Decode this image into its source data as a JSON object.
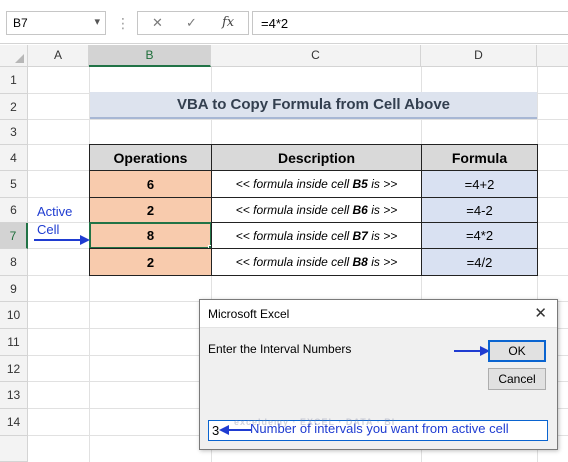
{
  "formula_bar": {
    "name_box": "B7",
    "cancel_glyph": "✕",
    "enter_glyph": "✓",
    "fx_label": "fx",
    "formula": "=4*2"
  },
  "columns": [
    "A",
    "B",
    "C",
    "D"
  ],
  "rows": [
    "1",
    "2",
    "3",
    "4",
    "5",
    "6",
    "7",
    "8",
    "9",
    "10",
    "11",
    "12",
    "13",
    "14"
  ],
  "sheet": {
    "title": "VBA to Copy Formula from Cell Above",
    "headers": [
      "Operations",
      "Description",
      "Formula"
    ],
    "data_rows": [
      {
        "operation": "6",
        "desc_prefix": "<< formula inside cell ",
        "desc_ref": "B5",
        "desc_suffix": " is >>",
        "formula": "=4+2"
      },
      {
        "operation": "2",
        "desc_prefix": "<< formula inside cell ",
        "desc_ref": "B6",
        "desc_suffix": " is >>",
        "formula": "=4-2"
      },
      {
        "operation": "8",
        "desc_prefix": "<< formula inside cell ",
        "desc_ref": "B7",
        "desc_suffix": " is >>",
        "formula": "=4*2"
      },
      {
        "operation": "2",
        "desc_prefix": "<< formula inside cell ",
        "desc_ref": "B8",
        "desc_suffix": " is >>",
        "formula": "=4/2"
      }
    ]
  },
  "annotation": {
    "active_line1": "Active",
    "active_line2": "Cell",
    "input_note": "Number of intervals you want from active cell"
  },
  "dialog": {
    "title": "Microsoft Excel",
    "prompt": "Enter the Interval Numbers",
    "ok_label": "OK",
    "cancel_label": "Cancel",
    "input_value": "3"
  },
  "watermark": "exceldemy · EXCEL · DATA · BI",
  "colors": {
    "accent_green": "#217346",
    "annotation_blue": "#1f3cd1",
    "operations_fill": "#f8cbad",
    "formula_fill": "#d9e1f2",
    "title_fill": "#dde3ee"
  }
}
